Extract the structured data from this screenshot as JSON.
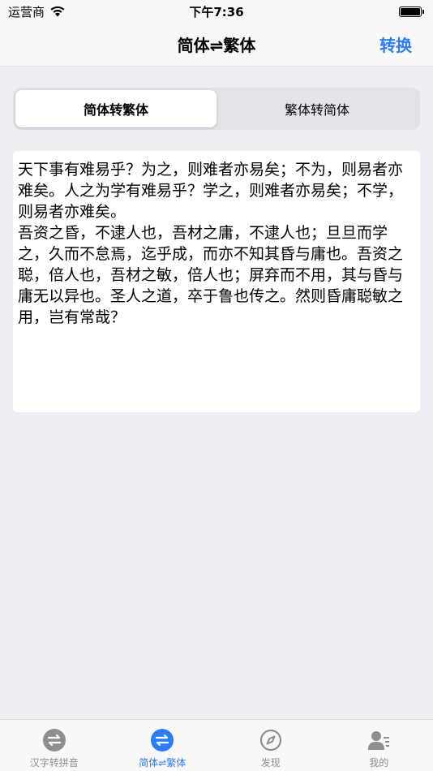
{
  "status_bar": {
    "carrier": "运营商",
    "time": "下午7:36"
  },
  "nav": {
    "title": "简体⇌繁体",
    "action": "转换"
  },
  "segments": [
    {
      "label": "简体转繁体",
      "active": true
    },
    {
      "label": "繁体转简体",
      "active": false
    }
  ],
  "editor": {
    "text": "天下事有难易乎？为之，则难者亦易矣；不为，则易者亦难矣。人之为学有难易乎？学之，则难者亦易矣；不学，则易者亦难矣。\n吾资之昏，不逮人也，吾材之庸，不逮人也；旦旦而学之，久而不怠焉，迄乎成，而亦不知其昏与庸也。吾资之聪，倍人也，吾材之敏，倍人也；屏弃而不用，其与昏与庸无以异也。圣人之道，卒于鲁也传之。然则昏庸聪敏之用，岂有常哉？"
  },
  "tabs": [
    {
      "label": "汉字转拼音",
      "icon": "swap-circle-icon",
      "active": false
    },
    {
      "label": "简体⇌繁体",
      "icon": "swap-circle-icon",
      "active": true
    },
    {
      "label": "发现",
      "icon": "compass-icon",
      "active": false
    },
    {
      "label": "我的",
      "icon": "profile-icon",
      "active": false
    }
  ],
  "colors": {
    "accent": "#2B7CF6",
    "inactive": "#8E8E93",
    "background": "#EFEEF4"
  }
}
